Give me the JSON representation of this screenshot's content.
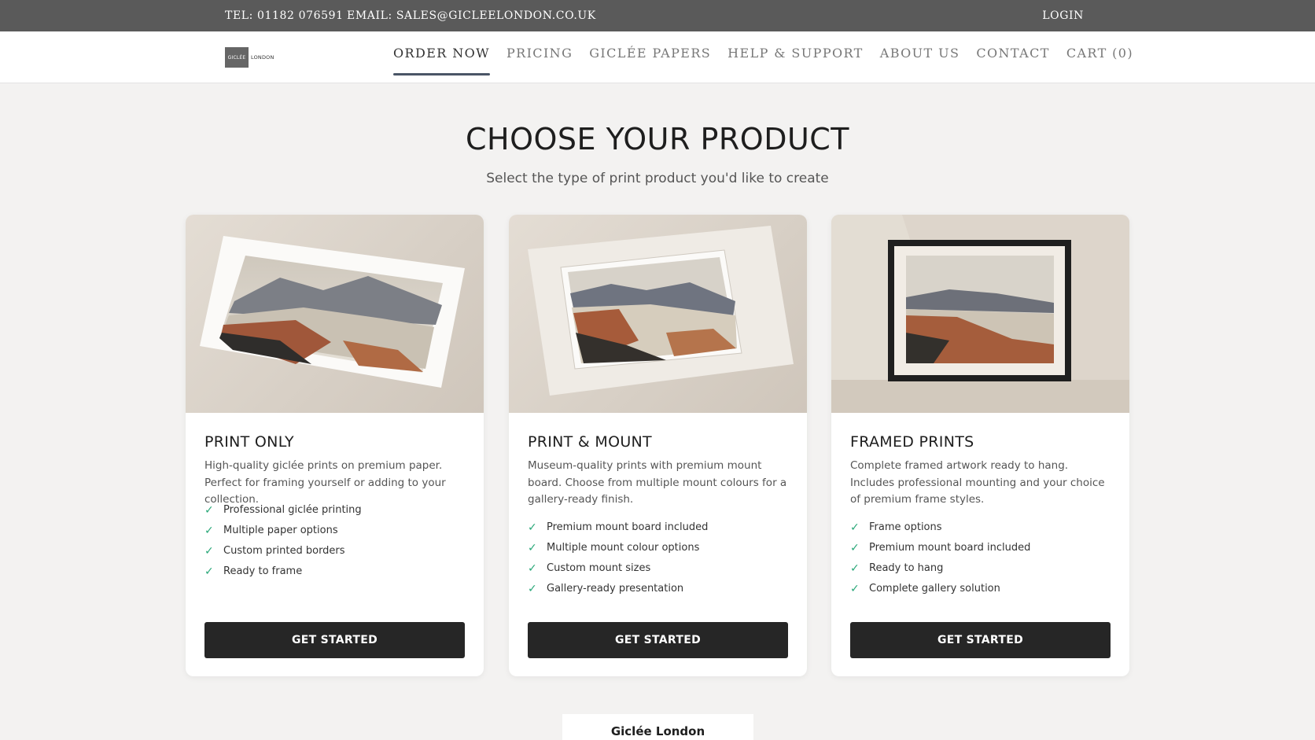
{
  "topbar": {
    "tel": "TEL: 01182 076591",
    "email": "EMAIL: SALES@GICLEELONDON.CO.UK",
    "login": "LOGIN"
  },
  "logo": {
    "box_text": "GICLÉE",
    "side_text": "LONDON"
  },
  "nav": [
    {
      "label": "ORDER NOW",
      "active": true
    },
    {
      "label": "PRICING"
    },
    {
      "label": "GICLÉE PAPERS"
    },
    {
      "label": "HELP & SUPPORT"
    },
    {
      "label": "ABOUT US"
    },
    {
      "label": "CONTACT"
    },
    {
      "label": "CART (0)"
    }
  ],
  "main": {
    "title": "CHOOSE YOUR PRODUCT",
    "subtitle": "Select the type of print product you'd like to create"
  },
  "cards": [
    {
      "title": "PRINT ONLY",
      "description": "High-quality giclée prints on premium paper. Perfect for framing yourself or adding to your collection.",
      "features": [
        "Professional giclée printing",
        "Multiple paper options",
        "Custom printed borders",
        "Ready to frame"
      ],
      "button": "GET STARTED"
    },
    {
      "title": "PRINT & MOUNT",
      "description": "Museum-quality prints with premium mount board. Choose from multiple mount colours for a gallery-ready finish.",
      "features": [
        "Premium mount board included",
        "Multiple mount colour options",
        "Custom mount sizes",
        "Gallery-ready presentation"
      ],
      "button": "GET STARTED"
    },
    {
      "title": "FRAMED PRINTS",
      "description": "Complete framed artwork ready to hang. Includes professional mounting and your choice of premium frame styles.",
      "features": [
        "Frame options",
        "Premium mount board included",
        "Ready to hang",
        "Complete gallery solution"
      ],
      "button": "GET STARTED"
    }
  ],
  "footer": {
    "badge": "Giclée London"
  },
  "icons": {
    "check": "check-icon",
    "check_color": "#2aa879"
  }
}
